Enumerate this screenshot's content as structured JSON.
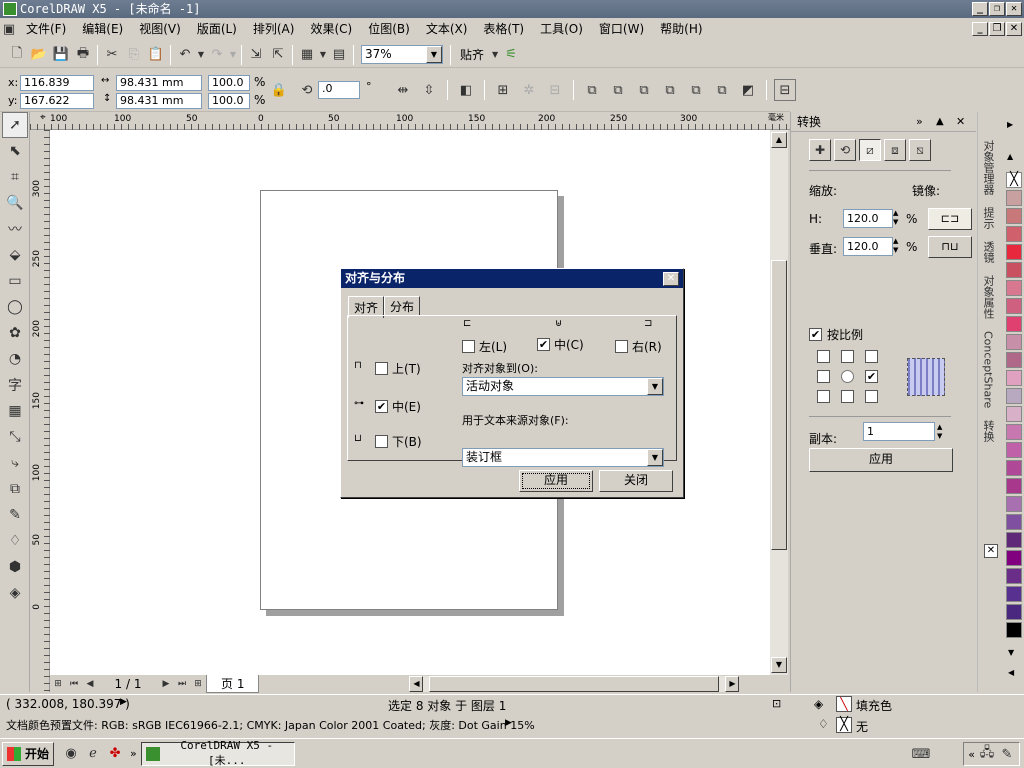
{
  "window": {
    "title": "CorelDRAW X5 - [未命名 -1]"
  },
  "menu": [
    "文件(F)",
    "编辑(E)",
    "视图(V)",
    "版面(L)",
    "排列(A)",
    "效果(C)",
    "位图(B)",
    "文本(X)",
    "表格(T)",
    "工具(O)",
    "窗口(W)",
    "帮助(H)"
  ],
  "toolbar": {
    "zoom": "37%",
    "snap_label": "贴齐"
  },
  "propbar": {
    "x": "116.839 mm",
    "y": "167.622 mm",
    "w": "98.431 mm",
    "h": "98.431 mm",
    "scale_x": "100.0",
    "scale_y": "100.0",
    "pct": "%",
    "angle": ".0",
    "deg": "°"
  },
  "ruler": {
    "h_ticks": [
      "100",
      "50",
      "0",
      "50",
      "100",
      "150",
      "200",
      "250",
      "300"
    ],
    "h_unit": "毫米",
    "v_ticks": [
      "300",
      "250",
      "200",
      "150",
      "100",
      "50",
      "0"
    ]
  },
  "dialog": {
    "title": "对齐与分布",
    "tabs": [
      "对齐",
      "分布"
    ],
    "left": "左(L)",
    "center": "中(C)",
    "right": "右(R)",
    "top": "上(T)",
    "middle": "中(E)",
    "bottom": "下(B)",
    "align_to_label": "对齐对象到(O):",
    "align_to_value": "活动对象",
    "text_src_label": "用于文本来源对象(F):",
    "text_src_value": "装订框",
    "apply": "应用",
    "close": "关闭"
  },
  "docker": {
    "title": "转换",
    "scale_label": "缩放:",
    "mirror_label": "镜像:",
    "h_label": "H:",
    "h_value": "120.0",
    "v_label": "垂直:",
    "v_value": "120.0",
    "pct": "%",
    "proportional": "按比例",
    "copies_label": "副本:",
    "copies_value": "1",
    "apply": "应用"
  },
  "vtabs": [
    "对象管理器",
    "提示",
    "透镜",
    "对象属性",
    "ConceptShare",
    "转换"
  ],
  "pagenav": {
    "counter": "1 / 1",
    "page_tab": "页 1"
  },
  "status": {
    "coords": "( 332.008, 180.397 )",
    "selection": "选定 8 对象 于 图层 1",
    "fill": "填充色",
    "outline": "无",
    "profile": "文档颜色预置文件: RGB: sRGB IEC61966-2.1; CMYK: Japan Color 2001 Coated; 灰度: Dot Gain 15%"
  },
  "taskbar": {
    "start": "开始",
    "task": "CorelDRAW X5 - [未..."
  },
  "palette": [
    "#c8a0a0",
    "#c87878",
    "#d0606c",
    "#e8283c",
    "#c85060",
    "#d87890",
    "#d06080",
    "#e04070",
    "#c890a8",
    "#b06888",
    "#e0a0c0",
    "#b8a8c0",
    "#d8b0c8",
    "#c878b0",
    "#c060a8",
    "#b04898",
    "#a8388c",
    "#a870b0",
    "#8050a0",
    "#602878",
    "#800080",
    "#6a2e88",
    "#583090",
    "#4a2880",
    "#000000"
  ]
}
